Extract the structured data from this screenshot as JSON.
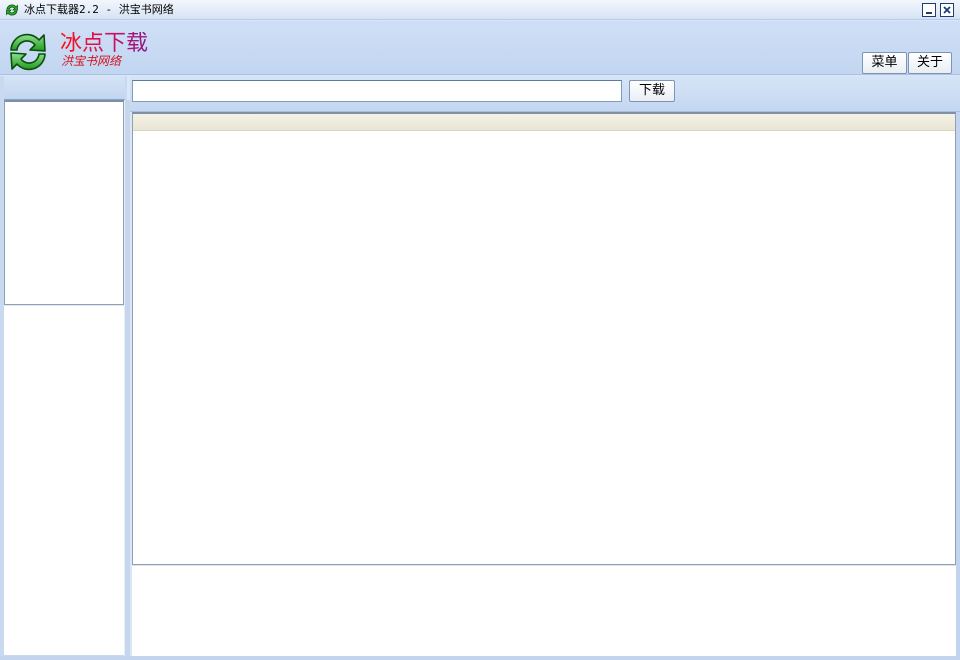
{
  "window": {
    "title": "冰点下载器2.2 - 洪宝书网络",
    "icon": "refresh-arrows-icon",
    "minimize_icon": "minimize-icon",
    "close_icon": "close-icon"
  },
  "header": {
    "logo_icon": "green-refresh-arrows-icon",
    "brand_name": "冰点下载",
    "brand_sub": "洪宝书网络",
    "menu_label": "菜单",
    "about_label": "关于"
  },
  "toolbar": {
    "url_value": "",
    "url_placeholder": "",
    "download_label": "下载"
  },
  "colors": {
    "accent": "#c6d8f2",
    "brand_red": "#ff1010",
    "brand_purple": "#8a1a8a",
    "logo_green": "#2fae2f"
  }
}
